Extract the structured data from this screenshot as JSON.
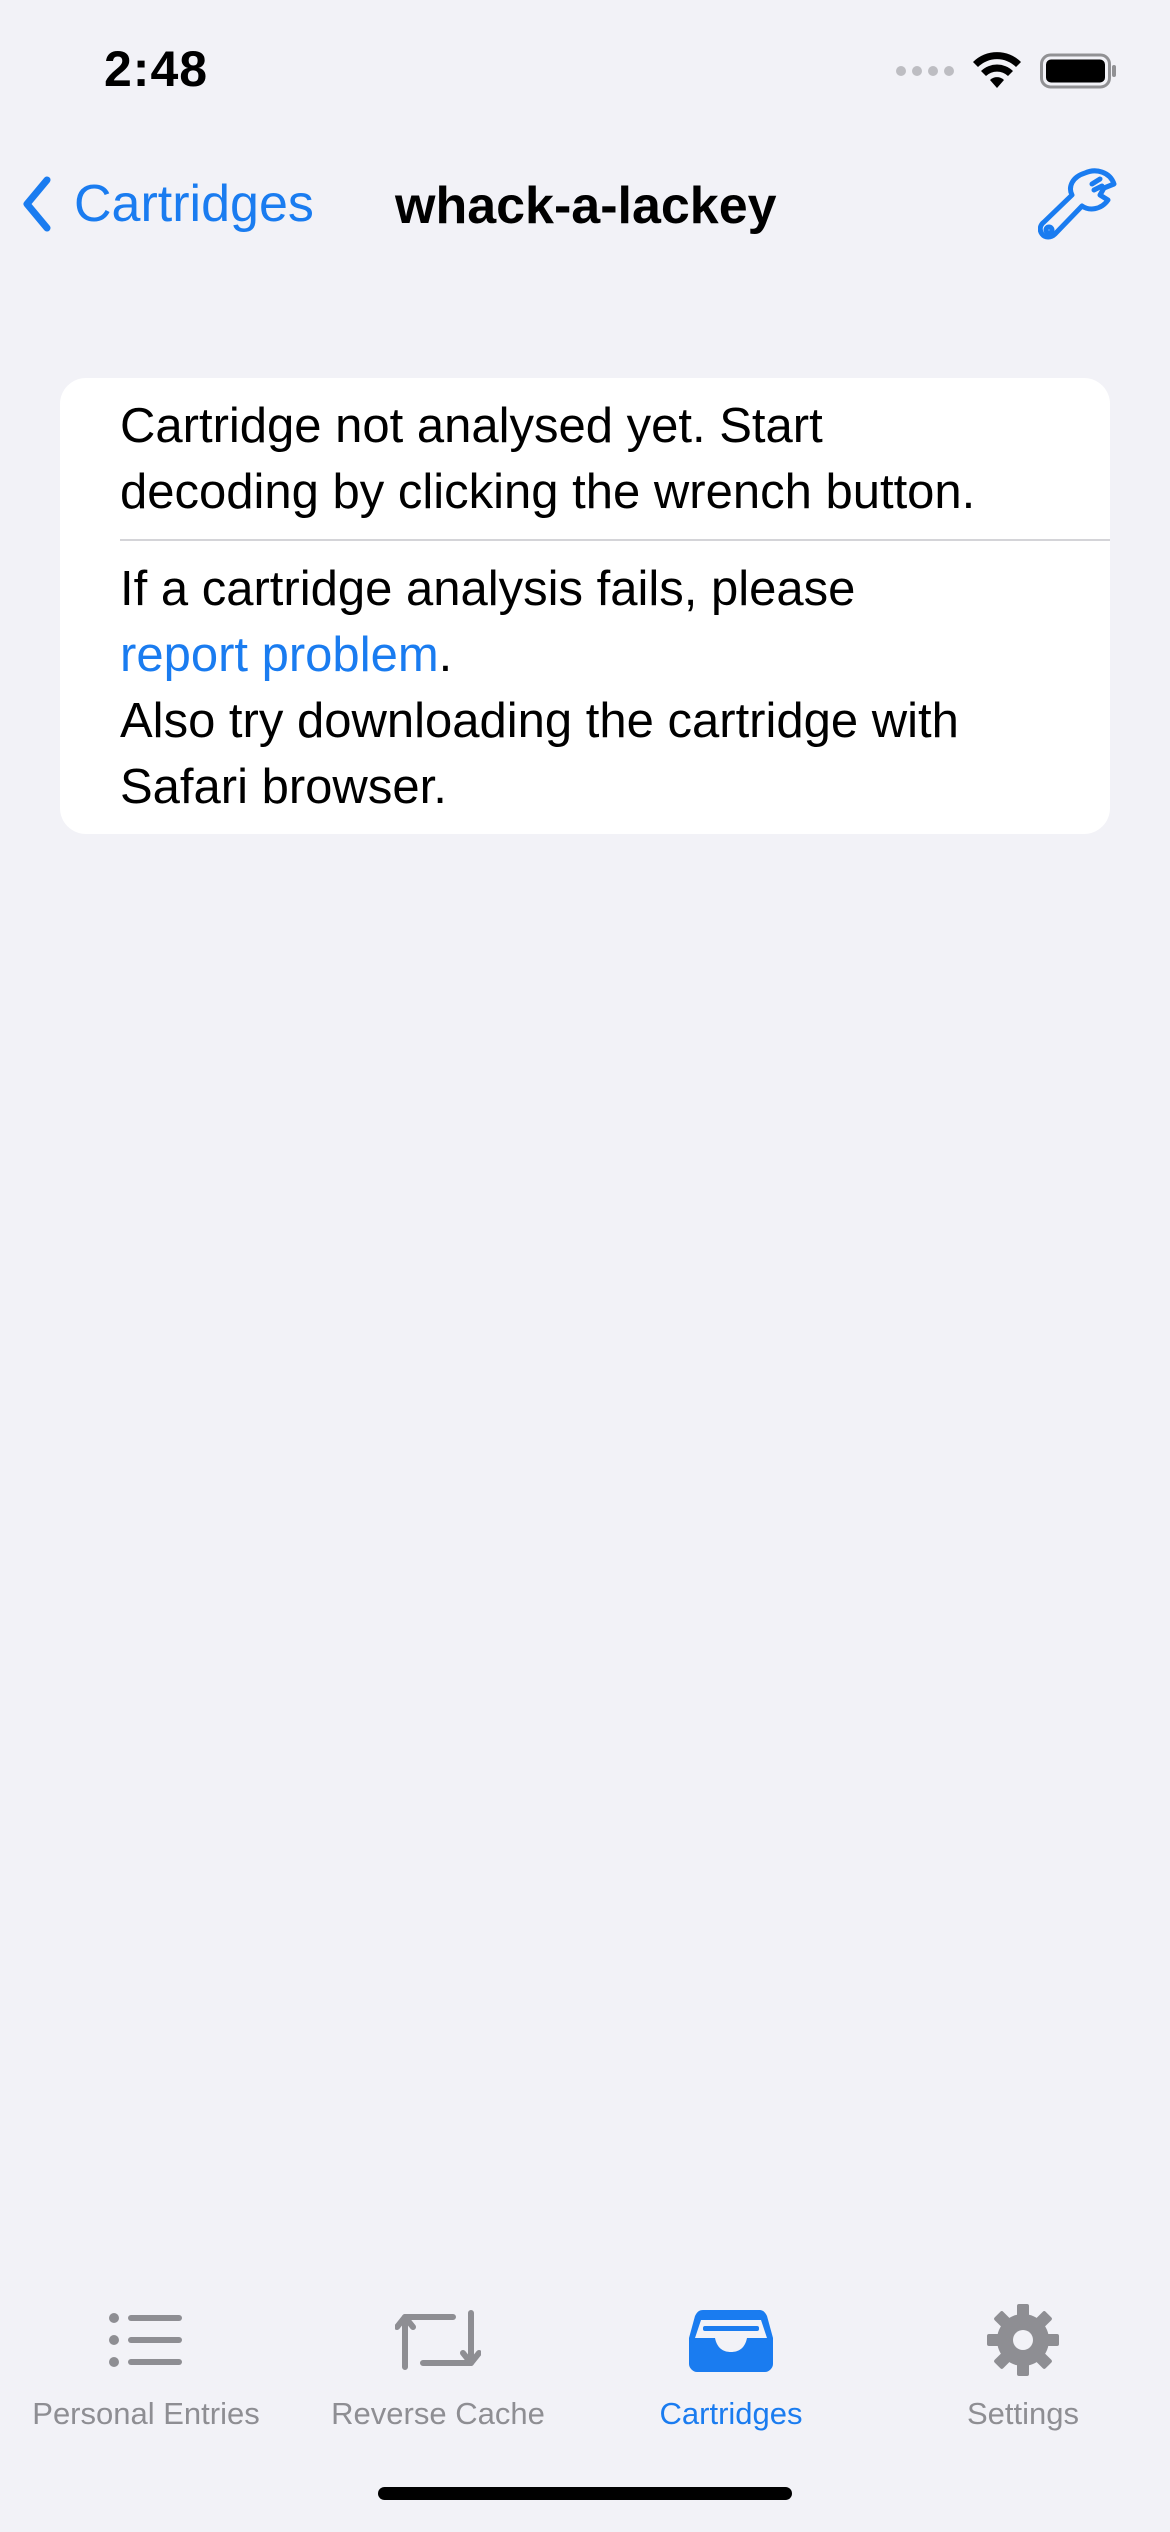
{
  "status_bar": {
    "time": "2:48"
  },
  "nav": {
    "back_label": "Cartridges",
    "title": "whack-a-lackey",
    "back_icon": "chevron-left-icon",
    "action_icon": "wrench-icon"
  },
  "card": {
    "message_line1": "Cartridge not analysed yet. Start",
    "message_line2": "decoding by clicking the wrench button.",
    "fail_prefix": "If a cartridge analysis fails, please",
    "report_link": "report problem",
    "report_suffix": ".",
    "safari_line1": "Also try downloading the cartridge with",
    "safari_line2": "Safari browser."
  },
  "tabs": [
    {
      "label": "Personal Entries",
      "icon": "list-icon",
      "active": false
    },
    {
      "label": "Reverse Cache",
      "icon": "sync-arrows-icon",
      "active": false
    },
    {
      "label": "Cartridges",
      "icon": "tray-icon",
      "active": true
    },
    {
      "label": "Settings",
      "icon": "gear-icon",
      "active": false
    }
  ],
  "colors": {
    "accent": "#1a7cf0",
    "background": "#f2f2f7",
    "inactive_tab": "#8e8e93"
  }
}
